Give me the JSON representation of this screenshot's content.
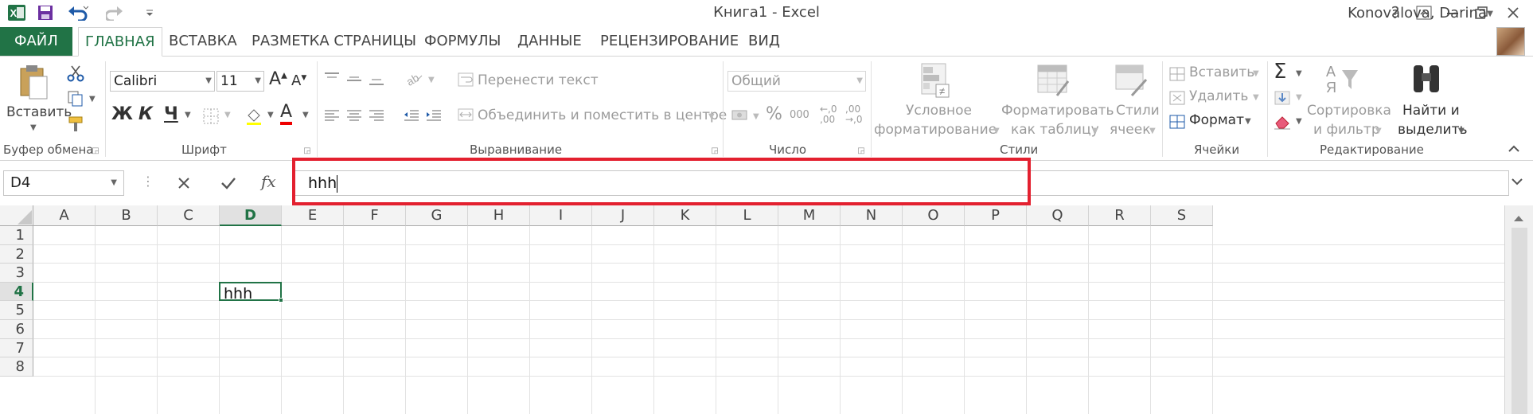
{
  "window": {
    "title": "Книга1 - Excel",
    "help": "?",
    "user": "Konovalova, Darina"
  },
  "tabs": [
    {
      "label": "ФАЙЛ"
    },
    {
      "label": "ГЛАВНАЯ"
    },
    {
      "label": "ВСТАВКА"
    },
    {
      "label": "РАЗМЕТКА СТРАНИЦЫ"
    },
    {
      "label": "ФОРМУЛЫ"
    },
    {
      "label": "ДАННЫЕ"
    },
    {
      "label": "РЕЦЕНЗИРОВАНИЕ"
    },
    {
      "label": "ВИД"
    }
  ],
  "ribbon": {
    "clipboard": {
      "paste": "Вставить",
      "group": "Буфер обмена"
    },
    "font": {
      "name": "Calibri",
      "size": "11",
      "bold": "Ж",
      "italic": "К",
      "underline": "Ч",
      "group": "Шрифт"
    },
    "alignment": {
      "wrap": "Перенести текст",
      "merge": "Объединить и поместить в центре",
      "group": "Выравнивание"
    },
    "number": {
      "format": "Общий",
      "percent": "%",
      "thousands": "000",
      "inc_decimal": "←,0 ,00",
      "dec_decimal": ",00 →,0",
      "group": "Число"
    },
    "styles": {
      "conditional_l1": "Условное",
      "conditional_l2": "форматирование",
      "table_l1": "Форматировать",
      "table_l2": "как таблицу",
      "cell_l1": "Стили",
      "cell_l2": "ячеек",
      "group": "Стили"
    },
    "cells": {
      "insert": "Вставить",
      "delete": "Удалить",
      "format": "Формат",
      "group": "Ячейки"
    },
    "editing": {
      "sort_l1": "Сортировка",
      "sort_l2": "и фильтр",
      "find_l1": "Найти и",
      "find_l2": "выделить",
      "group": "Редактирование"
    }
  },
  "formula_bar": {
    "name_box": "D4",
    "fx": "fx",
    "value": "hhh"
  },
  "sheet": {
    "columns": [
      "A",
      "B",
      "C",
      "D",
      "E",
      "F",
      "G",
      "H",
      "I",
      "J",
      "K",
      "L",
      "M",
      "N",
      "O",
      "P",
      "Q",
      "R",
      "S"
    ],
    "rows": [
      "1",
      "2",
      "3",
      "4",
      "5",
      "6",
      "7",
      "8"
    ],
    "active_cell": "D4",
    "active_value": "hhh"
  },
  "colors": {
    "accent": "#217346",
    "highlight": "#e3202f"
  }
}
